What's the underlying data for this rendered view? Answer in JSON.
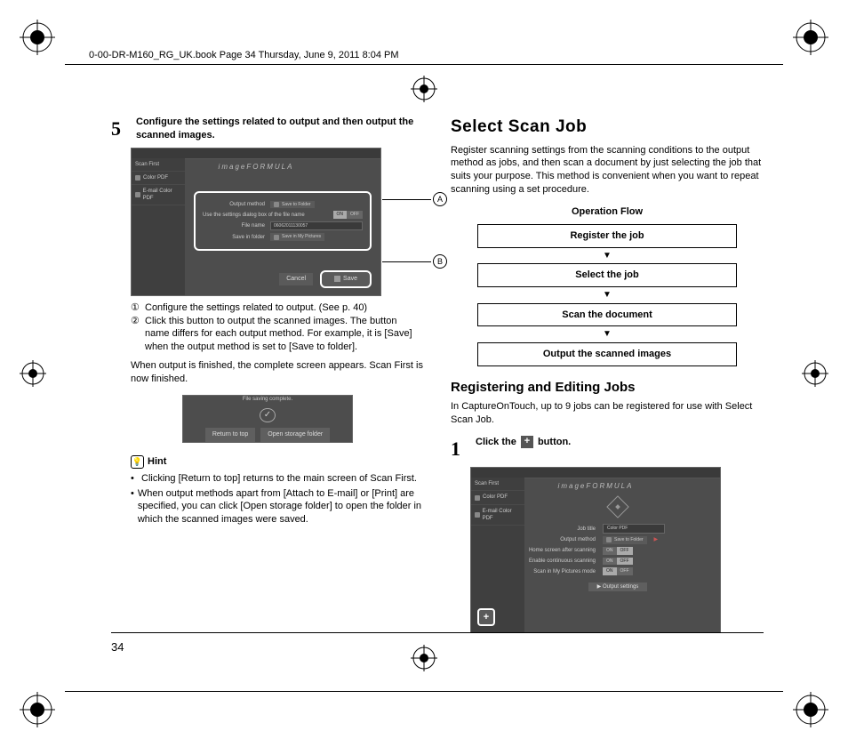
{
  "header": "0-00-DR-M160_RG_UK.book  Page 34  Thursday, June 9, 2011  8:04 PM",
  "page_number": "34",
  "left": {
    "step_num": "5",
    "step_text": "Configure the settings related to output and then output the scanned images.",
    "win1": {
      "brand": "imageFORMULA",
      "side": [
        "Scan First",
        "Color PDF",
        "E-mail Color PDF"
      ],
      "rows": {
        "method_label": "Output method",
        "method_val": "Save to Folder",
        "opt_label": "Use the settings dialog box of the file name",
        "on": "ON",
        "off": "OFF",
        "fn_label": "File name",
        "fn_val": "06062011130057",
        "folder_label": "Save in folder",
        "folder_val": "Save in My Pictures"
      },
      "cancel": "Cancel",
      "save": "Save"
    },
    "callouts": {
      "c1": "①",
      "c2": "②",
      "a": "A",
      "b": "B"
    },
    "legend": {
      "l1": "Configure the settings related to output. (See p. 40)",
      "l2a": "Click this button to output the scanned images. The button name differs for each output method. For example, it is [Save] when the output method is set to [Save to folder]."
    },
    "para_after": "When output is finished, the complete screen appears. Scan First is now finished.",
    "win2": {
      "msg": "File saving complete.",
      "btn1": "Return to top",
      "btn2": "Open storage folder"
    },
    "hint_label": "Hint",
    "hints": [
      "Clicking [Return to top] returns to the main screen of Scan First.",
      "When output methods apart from [Attach to E-mail] or [Print] are specified, you can click [Open storage folder] to open the folder in which the scanned images were saved."
    ]
  },
  "right": {
    "title": "Select Scan Job",
    "intro": "Register scanning settings from the scanning conditions to the output method as jobs, and then scan a document by just selecting the job that suits your purpose. This method is convenient when you want to repeat scanning using a set procedure.",
    "flow": {
      "title": "Operation Flow",
      "b1": "Register the job",
      "b2": "Select the job",
      "b3": "Scan the document",
      "b4": "Output the scanned images",
      "arrow": "▼"
    },
    "sub_title": "Registering and Editing Jobs",
    "sub_intro": "In CaptureOnTouch, up to 9 jobs can be registered for use with Select Scan Job.",
    "step_num": "1",
    "step_text_a": "Click the ",
    "step_text_b": " button.",
    "win3": {
      "brand": "imageFORMULA",
      "side": [
        "Scan First",
        "Color PDF",
        "E-mail Color PDF"
      ],
      "rows": {
        "title_label": "Job title",
        "title_val": "Color PDF",
        "out_label": "Output method",
        "out_val": "Save to Folder",
        "home_label": "Home screen after scanning",
        "on": "ON",
        "off": "OFF",
        "cont_label": "Enable continuous scanning",
        "on2": "ON",
        "off2": "OFF",
        "pw_label": "Scan in My Pictures mode",
        "on3": "ON",
        "off3": "OFF"
      },
      "output_btn": "Output settings"
    },
    "plus": "+"
  }
}
